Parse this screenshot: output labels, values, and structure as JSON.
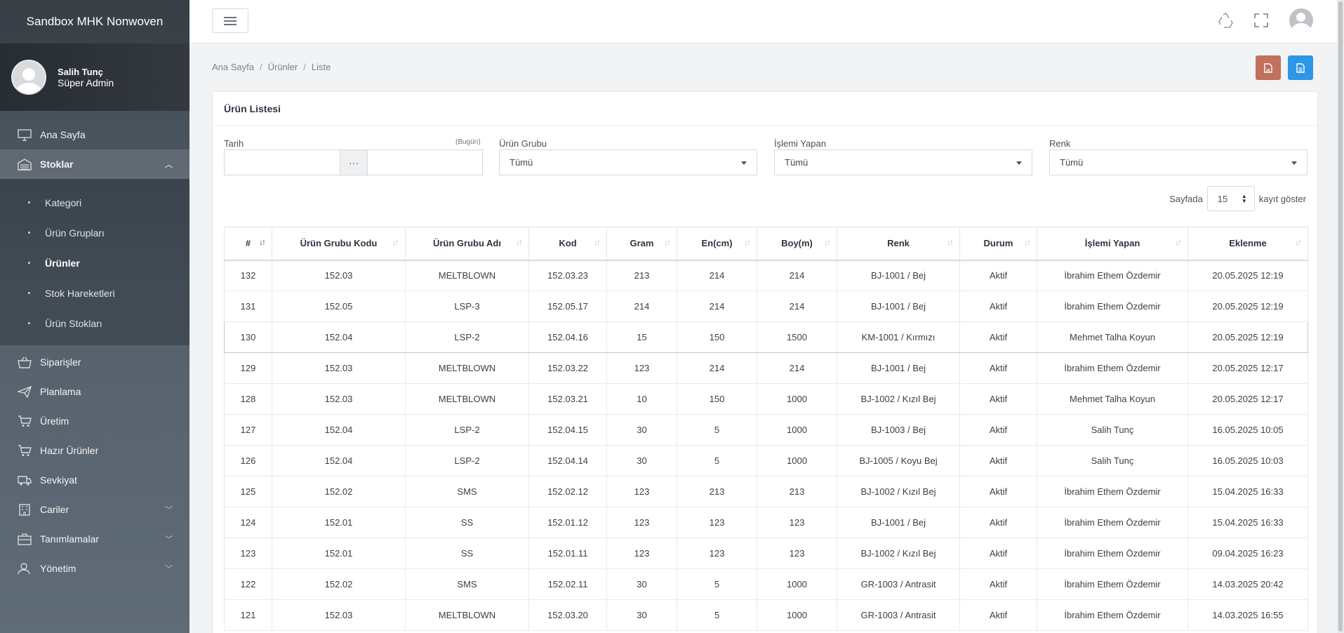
{
  "app": {
    "brand": "Sandbox MHK Nonwoven"
  },
  "user": {
    "name": "Salih Tunç",
    "role": "Süper Admin"
  },
  "sidebar": {
    "items": [
      {
        "label": "Ana Sayfa",
        "icon": "monitor-icon"
      },
      {
        "label": "Stoklar",
        "icon": "warehouse-icon"
      }
    ],
    "stok_sub": [
      "Kategori",
      "Ürün Grupları",
      "Ürünler",
      "Stok Hareketleri",
      "Ürün Stokları"
    ],
    "items_after": [
      {
        "label": "Siparişler",
        "icon": "basket-icon"
      },
      {
        "label": "Planlama",
        "icon": "paper-plane-icon"
      },
      {
        "label": "Üretim",
        "icon": "cart-icon"
      },
      {
        "label": "Hazır Ürünler",
        "icon": "cart-icon"
      },
      {
        "label": "Sevkiyat",
        "icon": "truck-icon"
      },
      {
        "label": "Cariler",
        "icon": "building-icon"
      },
      {
        "label": "Tanımlamalar",
        "icon": "briefcase-icon"
      },
      {
        "label": "Yönetim",
        "icon": "user-cog-icon"
      }
    ]
  },
  "breadcrumb": [
    "Ana Sayfa",
    "Ürünler",
    "Liste"
  ],
  "card": {
    "title": "Ürün Listesi"
  },
  "filters": {
    "date_label": "Tarih",
    "date_hint": "(Bugün)",
    "date_separator": "···",
    "group_label": "Ürün Grubu",
    "group_value": "Tümü",
    "user_label": "İşlemi Yapan",
    "user_value": "Tümü",
    "color_label": "Renk",
    "color_value": "Tümü"
  },
  "pager": {
    "prefix": "Sayfada",
    "value": "15",
    "suffix": "kayıt göster"
  },
  "table": {
    "headers": [
      "#",
      "Ürün Grubu Kodu",
      "Ürün Grubu Adı",
      "Kod",
      "Gram",
      "En(cm)",
      "Boy(m)",
      "Renk",
      "Durum",
      "İşlemi Yapan",
      "Eklenme"
    ],
    "rows": [
      [
        "132",
        "152.03",
        "MELTBLOWN",
        "152.03.23",
        "213",
        "214",
        "214",
        "BJ-1001 / Bej",
        "Aktif",
        "İbrahim Ethem Özdemir",
        "20.05.2025 12:19"
      ],
      [
        "131",
        "152.05",
        "LSP-3",
        "152.05.17",
        "214",
        "214",
        "214",
        "BJ-1001 / Bej",
        "Aktif",
        "İbrahim Ethem Özdemir",
        "20.05.2025 12:19"
      ],
      [
        "130",
        "152.04",
        "LSP-2",
        "152.04.16",
        "15",
        "150",
        "1500",
        "KM-1001 / Kırmızı",
        "Aktif",
        "Mehmet Talha Koyun",
        "20.05.2025 12:19"
      ],
      [
        "129",
        "152.03",
        "MELTBLOWN",
        "152.03.22",
        "123",
        "214",
        "214",
        "BJ-1001 / Bej",
        "Aktif",
        "İbrahim Ethem Özdemir",
        "20.05.2025 12:17"
      ],
      [
        "128",
        "152.03",
        "MELTBLOWN",
        "152.03.21",
        "10",
        "150",
        "1000",
        "BJ-1002 / Kızıl Bej",
        "Aktif",
        "Mehmet Talha Koyun",
        "20.05.2025 12:17"
      ],
      [
        "127",
        "152.04",
        "LSP-2",
        "152.04.15",
        "30",
        "5",
        "1000",
        "BJ-1003 / Bej",
        "Aktif",
        "Salih Tunç",
        "16.05.2025 10:05"
      ],
      [
        "126",
        "152.04",
        "LSP-2",
        "152.04.14",
        "30",
        "5",
        "1000",
        "BJ-1005 / Koyu Bej",
        "Aktif",
        "Salih Tunç",
        "16.05.2025 10:03"
      ],
      [
        "125",
        "152.02",
        "SMS",
        "152.02.12",
        "123",
        "213",
        "213",
        "BJ-1002 / Kızıl Bej",
        "Aktif",
        "İbrahim Ethem Özdemir",
        "15.04.2025 16:33"
      ],
      [
        "124",
        "152.01",
        "SS",
        "152.01.12",
        "123",
        "123",
        "123",
        "BJ-1001 / Bej",
        "Aktif",
        "İbrahim Ethem Özdemir",
        "15.04.2025 16:33"
      ],
      [
        "123",
        "152.01",
        "SS",
        "152.01.11",
        "123",
        "123",
        "123",
        "BJ-1002 / Kızıl Bej",
        "Aktif",
        "İbrahim Ethem Özdemir",
        "09.04.2025 16:23"
      ],
      [
        "122",
        "152.02",
        "SMS",
        "152.02.11",
        "30",
        "5",
        "1000",
        "GR-1003 / Antrasit",
        "Aktif",
        "İbrahim Ethem Özdemir",
        "14.03.2025 20:42"
      ],
      [
        "121",
        "152.03",
        "MELTBLOWN",
        "152.03.20",
        "30",
        "5",
        "1000",
        "GR-1003 / Antrasit",
        "Aktif",
        "İbrahim Ethem Özdemir",
        "14.03.2025 16:55"
      ]
    ]
  },
  "colors": {
    "pdf_button": "#c0705c",
    "doc_button": "#2e96e6",
    "sidebar_dark": "#3f4850"
  }
}
